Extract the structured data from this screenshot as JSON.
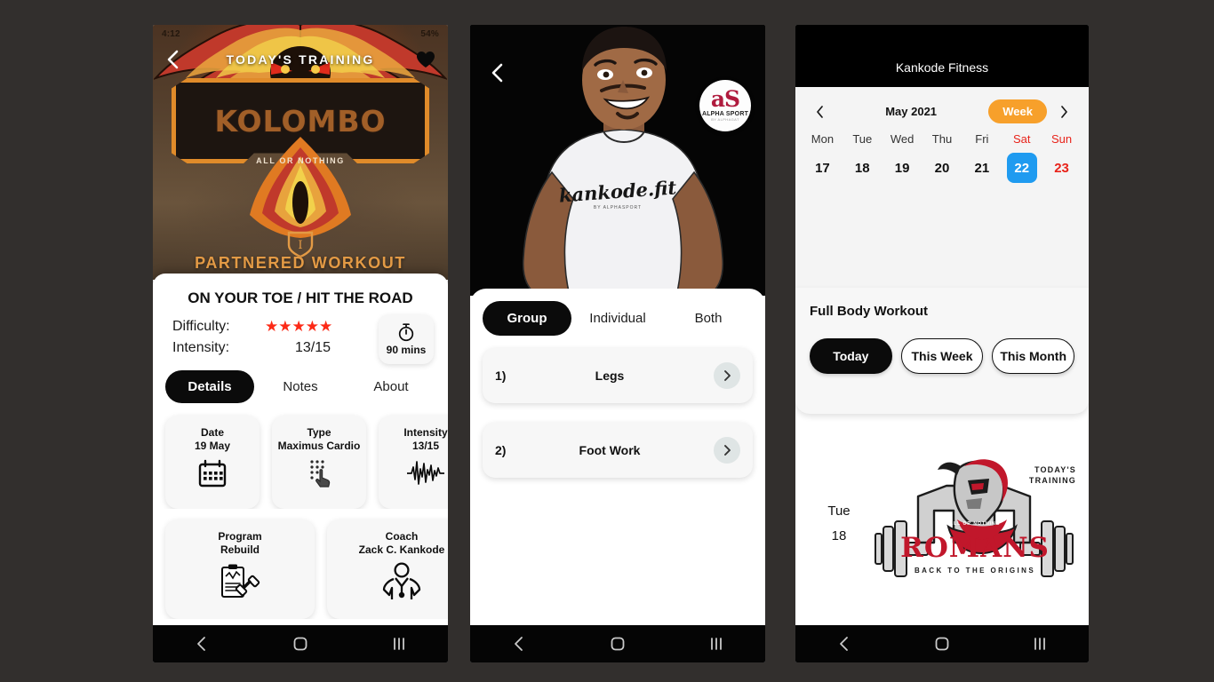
{
  "background_color": "#322f2d",
  "phone1": {
    "name": "workout-detail-screen",
    "status_bar": {
      "time": "4:12",
      "right": "54%"
    },
    "hero": {
      "back_icon": "chevron-left-icon",
      "title": "TODAY'S TRAINING",
      "favorite_icon": "heart-icon",
      "logo_word": "KOLOMBO",
      "logo_tagline": "ALL OR NOTHING",
      "caption": "PARTNERED WORKOUT"
    },
    "heading": "ON YOUR TOE / HIT THE ROAD",
    "meta": [
      {
        "label": "Difficulty:",
        "value": "★★★★★",
        "type": "stars",
        "stars": 5
      },
      {
        "label": "Intensity:",
        "value": "13/15",
        "type": "text"
      }
    ],
    "timer": {
      "icon": "stopwatch-icon",
      "value": "90 mins"
    },
    "tabs": [
      {
        "label": "Details",
        "active": true
      },
      {
        "label": "Notes",
        "active": false
      },
      {
        "label": "About",
        "active": false
      }
    ],
    "cards_row1": [
      {
        "title": "Date",
        "value": "19 May",
        "icon": "calendar-icon"
      },
      {
        "title": "Type",
        "value": "Maximus Cardio",
        "icon": "tap-gesture-icon"
      },
      {
        "title": "Intensity",
        "value": "13/15",
        "icon": "waveform-icon"
      }
    ],
    "cards_row2": [
      {
        "title": "Program",
        "value": "Rebuild",
        "icon": "clipboard-dumbbell-icon"
      },
      {
        "title": "Coach",
        "value": "Zack C. Kankode",
        "icon": "coach-icon"
      }
    ],
    "nav": {
      "back": "back-icon",
      "home": "home-icon",
      "recents": "recents-icon"
    }
  },
  "phone2": {
    "name": "workout-exercises-screen",
    "hero": {
      "back_icon": "chevron-left-icon",
      "shirt_text": "kankode.fit",
      "shirt_sub": "BY ALPHASPORT",
      "logo_mark": "aS",
      "logo_name": "ALPHA SPORT",
      "logo_sub": "BY ALPHAGAT"
    },
    "segments": [
      {
        "label": "Group",
        "active": true
      },
      {
        "label": "Individual",
        "active": false
      },
      {
        "label": "Both",
        "active": false
      }
    ],
    "exercises": [
      {
        "index": "1)",
        "name": "Legs",
        "chevron": "chevron-right-icon"
      },
      {
        "index": "2)",
        "name": "Foot Work",
        "chevron": "chevron-right-icon"
      }
    ],
    "nav": {
      "back": "back-icon",
      "home": "home-icon",
      "recents": "recents-icon"
    }
  },
  "phone3": {
    "name": "calendar-schedule-screen",
    "app_title": "Kankode Fitness",
    "calendar": {
      "prev_icon": "chevron-left-icon",
      "month": "May 2021",
      "view_toggle": "Week",
      "next_icon": "chevron-right-icon",
      "days": [
        {
          "dow": "Mon",
          "num": "17",
          "weekend": false,
          "selected": false
        },
        {
          "dow": "Tue",
          "num": "18",
          "weekend": false,
          "selected": false
        },
        {
          "dow": "Wed",
          "num": "19",
          "weekend": false,
          "selected": false
        },
        {
          "dow": "Thu",
          "num": "20",
          "weekend": false,
          "selected": false
        },
        {
          "dow": "Fri",
          "num": "21",
          "weekend": false,
          "selected": false
        },
        {
          "dow": "Sat",
          "num": "22",
          "weekend": true,
          "selected": true
        },
        {
          "dow": "Sun",
          "num": "23",
          "weekend": true,
          "selected": false
        }
      ],
      "selected_color": "#1f9bf0",
      "weekend_color": "#e8231a",
      "week_chip_color": "#f7a02b"
    },
    "section": {
      "title": "Full Body Workout",
      "filters": [
        {
          "label": "Today",
          "active": true
        },
        {
          "label": "This Week",
          "active": false
        },
        {
          "label": "This Month",
          "active": false
        }
      ]
    },
    "workout_entry": {
      "day": "Tue",
      "date": "18",
      "logo_word": "ROMANS",
      "logo_sub": "BACK TO THE ORIGINS",
      "logo_tagline": "ALL OR NOTHING",
      "badge_line1": "TODAY'S",
      "badge_line2": "TRAINING"
    },
    "nav": {
      "back": "back-icon",
      "home": "home-icon",
      "recents": "recents-icon"
    }
  }
}
